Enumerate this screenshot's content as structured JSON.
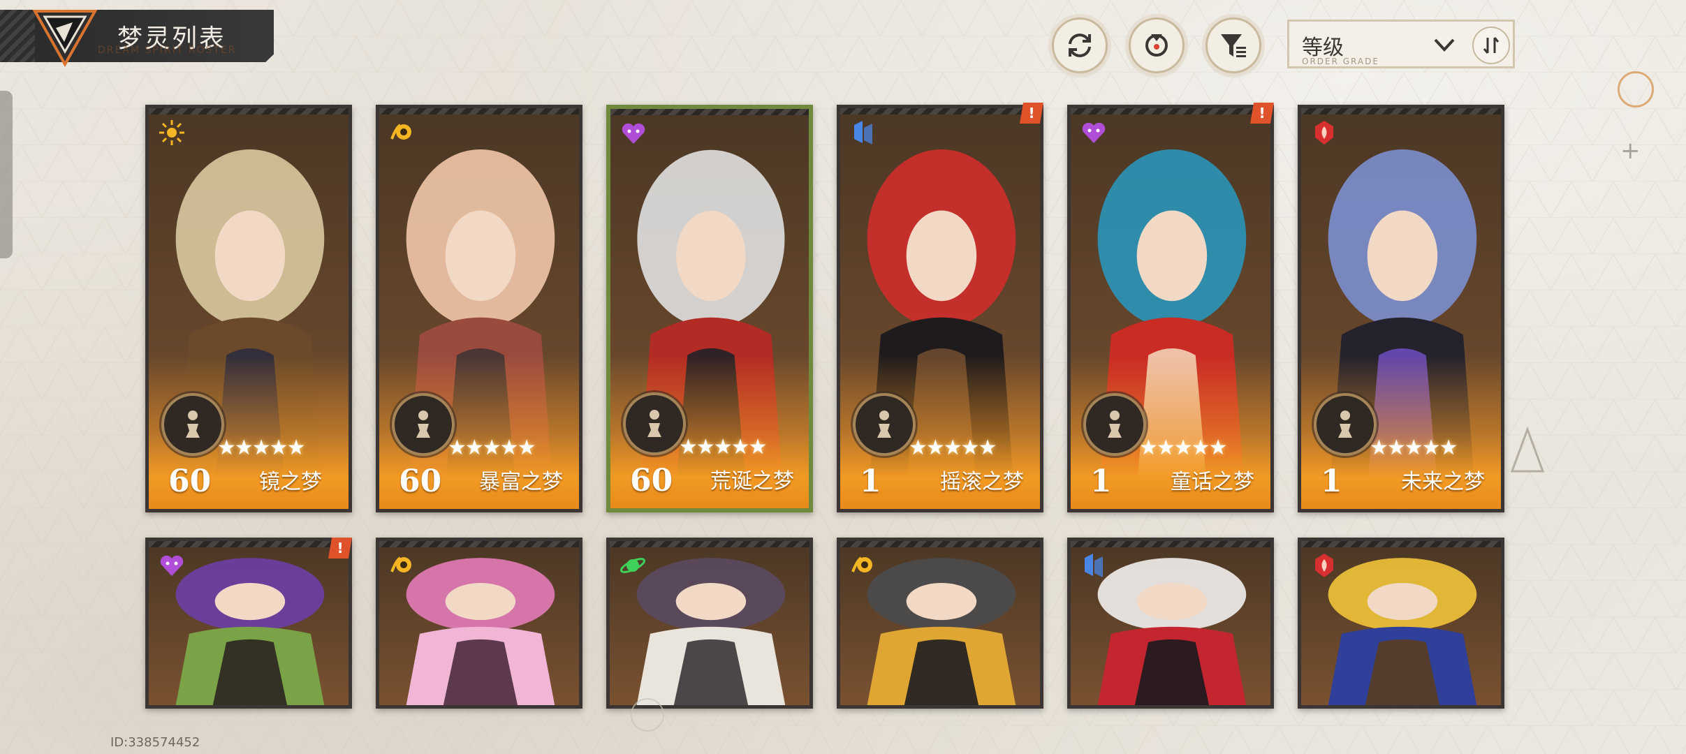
{
  "header": {
    "title": "梦灵列表",
    "subtitle": "DREAM SPIRIT ROSTER"
  },
  "toolbar": {
    "refresh_icon": "refresh-icon",
    "target_icon": "target-icon",
    "filter_icon": "filter-icon",
    "sort": {
      "selected": "等级",
      "sub": "ORDER GRADE"
    }
  },
  "characters_row1": [
    {
      "level": "60",
      "name": "镜之梦",
      "element_color": "#f5b623",
      "element": "sun-icon",
      "selected": false,
      "alert": false,
      "art": [
        "#d9c9a0",
        "#6a4a2a",
        "#2d2b3e"
      ]
    },
    {
      "level": "60",
      "name": "暴富之梦",
      "element_color": "#f5b623",
      "element": "coin-icon",
      "selected": false,
      "alert": false,
      "art": [
        "#f1c6a8",
        "#9b4b3e",
        "#403434"
      ]
    },
    {
      "level": "60",
      "name": "荒诞之梦",
      "element_color": "#b14ed8",
      "element": "heart-icon",
      "selected": true,
      "alert": false,
      "art": [
        "#e0e0e0",
        "#b22b24",
        "#202027"
      ]
    },
    {
      "level": "1",
      "name": "摇滚之梦",
      "element_color": "#4a86e6",
      "element": "crystal-icon",
      "selected": false,
      "alert": true,
      "art": [
        "#cf2d2b",
        "#1f1b1c",
        "#6b4a30"
      ]
    },
    {
      "level": "1",
      "name": "童话之梦",
      "element_color": "#b14ed8",
      "element": "heart-icon",
      "selected": false,
      "alert": true,
      "art": [
        "#2a95b8",
        "#c92b25",
        "#f2d2b6"
      ]
    },
    {
      "level": "1",
      "name": "未来之梦",
      "element_color": "#d83030",
      "element": "flame-icon",
      "selected": false,
      "alert": false,
      "art": [
        "#7c8fcf",
        "#23222d",
        "#6a4bb8"
      ]
    }
  ],
  "characters_row2": [
    {
      "element": "heart-icon",
      "element_color": "#b14ed8",
      "alert": true,
      "art": [
        "#6b3fa6",
        "#7aa246",
        "#2b2320"
      ]
    },
    {
      "element": "coin-icon",
      "element_color": "#f5b623",
      "alert": false,
      "art": [
        "#e37bb8",
        "#f1b5d5",
        "#4d2b3e"
      ]
    },
    {
      "element": "planet-icon",
      "element_color": "#3fd05a",
      "alert": false,
      "art": [
        "#5a4a60",
        "#e9e4dc",
        "#3c3437"
      ]
    },
    {
      "element": "coin-icon",
      "element_color": "#f5b623",
      "alert": false,
      "art": [
        "#4b4b4e",
        "#e0a633",
        "#1e1d20"
      ]
    },
    {
      "element": "crystal-icon",
      "element_color": "#4a86e6",
      "alert": false,
      "art": [
        "#f3f0ee",
        "#c3262f",
        "#1b1a1e"
      ]
    },
    {
      "element": "flame-icon",
      "element_color": "#d83030",
      "alert": false,
      "art": [
        "#f1c43a",
        "#2f3f9a",
        "#5a3d22"
      ]
    }
  ],
  "footer": {
    "id": "ID:338574452"
  }
}
